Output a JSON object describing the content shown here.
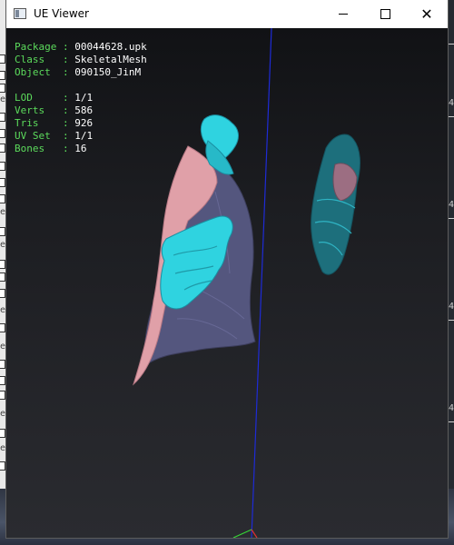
{
  "window": {
    "title": "UE Viewer",
    "controls": {
      "minimize": "minimize",
      "maximize": "maximize",
      "close": "close"
    }
  },
  "info": {
    "package_label": "Package",
    "package_value": "00044628.upk",
    "class_label": "Class",
    "class_value": "SkeletalMesh",
    "object_label": "Object",
    "object_value": "090150_JinM",
    "lod_label": "LOD",
    "lod_value": "1/1",
    "verts_label": "Verts",
    "verts_value": "586",
    "tris_label": "Tris",
    "tris_value": "926",
    "uvset_label": "UV Set",
    "uvset_value": "1/1",
    "bones_label": "Bones",
    "bones_value": "16",
    "separator": ":"
  },
  "background": {
    "left_glyph": "e",
    "right_digit": "4"
  },
  "colors": {
    "label_green": "#5cdb5c",
    "value_white": "#ffffff",
    "axis_blue": "#1e2bd6",
    "mesh_cyan": "#2fd3e0",
    "mesh_pink": "#e0a0a8",
    "mesh_purple": "#54567e"
  }
}
